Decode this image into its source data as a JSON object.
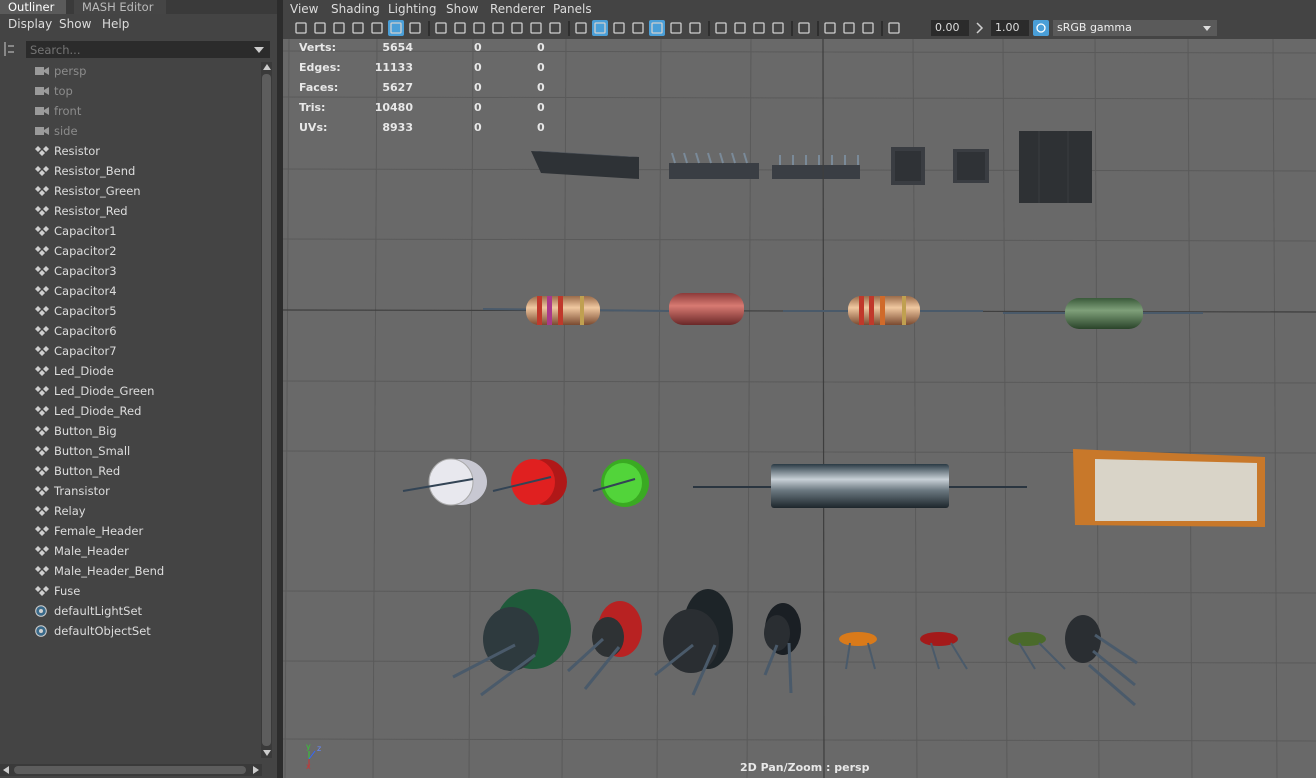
{
  "outliner": {
    "tabs": [
      "Outliner",
      "MASH Editor"
    ],
    "menu": [
      "Display",
      "Show",
      "Help"
    ],
    "search_placeholder": "Search...",
    "items": [
      {
        "label": "persp",
        "type": "camera",
        "dim": true
      },
      {
        "label": "top",
        "type": "camera",
        "dim": true
      },
      {
        "label": "front",
        "type": "camera",
        "dim": true
      },
      {
        "label": "side",
        "type": "camera",
        "dim": true
      },
      {
        "label": "Resistor",
        "type": "transform",
        "dim": false
      },
      {
        "label": "Resistor_Bend",
        "type": "transform",
        "dim": false
      },
      {
        "label": "Resistor_Green",
        "type": "transform",
        "dim": false
      },
      {
        "label": "Resistor_Red",
        "type": "transform",
        "dim": false
      },
      {
        "label": "Capacitor1",
        "type": "transform",
        "dim": false
      },
      {
        "label": "Capacitor2",
        "type": "transform",
        "dim": false
      },
      {
        "label": "Capacitor3",
        "type": "transform",
        "dim": false
      },
      {
        "label": "Capacitor4",
        "type": "transform",
        "dim": false
      },
      {
        "label": "Capacitor5",
        "type": "transform",
        "dim": false
      },
      {
        "label": "Capacitor6",
        "type": "transform",
        "dim": false
      },
      {
        "label": "Capacitor7",
        "type": "transform",
        "dim": false
      },
      {
        "label": "Led_Diode",
        "type": "transform",
        "dim": false
      },
      {
        "label": "Led_Diode_Green",
        "type": "transform",
        "dim": false
      },
      {
        "label": "Led_Diode_Red",
        "type": "transform",
        "dim": false
      },
      {
        "label": "Button_Big",
        "type": "transform",
        "dim": false
      },
      {
        "label": "Button_Small",
        "type": "transform",
        "dim": false
      },
      {
        "label": "Button_Red",
        "type": "transform",
        "dim": false
      },
      {
        "label": "Transistor",
        "type": "transform",
        "dim": false
      },
      {
        "label": "Relay",
        "type": "transform",
        "dim": false
      },
      {
        "label": "Female_Header",
        "type": "transform",
        "dim": false
      },
      {
        "label": "Male_Header",
        "type": "transform",
        "dim": false
      },
      {
        "label": "Male_Header_Bend",
        "type": "transform",
        "dim": false
      },
      {
        "label": "Fuse",
        "type": "transform",
        "dim": false
      },
      {
        "label": "defaultLightSet",
        "type": "set",
        "dim": false
      },
      {
        "label": "defaultObjectSet",
        "type": "set",
        "dim": false
      }
    ]
  },
  "viewport": {
    "menu": [
      "View",
      "Shading",
      "Lighting",
      "Show",
      "Renderer",
      "Panels"
    ],
    "exposure": "0.00",
    "gamma": "1.00",
    "color_space": "sRGB gamma",
    "hud": [
      {
        "label": "Verts:",
        "v1": "5654",
        "v2": "0",
        "v3": "0"
      },
      {
        "label": "Edges:",
        "v1": "11133",
        "v2": "0",
        "v3": "0"
      },
      {
        "label": "Faces:",
        "v1": "5627",
        "v2": "0",
        "v3": "0"
      },
      {
        "label": "Tris:",
        "v1": "10480",
        "v2": "0",
        "v3": "0"
      },
      {
        "label": "UVs:",
        "v1": "8933",
        "v2": "0",
        "v3": "0"
      }
    ],
    "camera_label": "2D Pan/Zoom : persp",
    "axis": {
      "x": "x",
      "y": "y",
      "z": "z"
    }
  },
  "colors": {
    "panel_bg": "#444444",
    "viewport_bg": "#696969",
    "grid": "#5a5a5a",
    "grid_axis": "#3e3e3e",
    "active_toolbar": "#4a9fd8"
  }
}
